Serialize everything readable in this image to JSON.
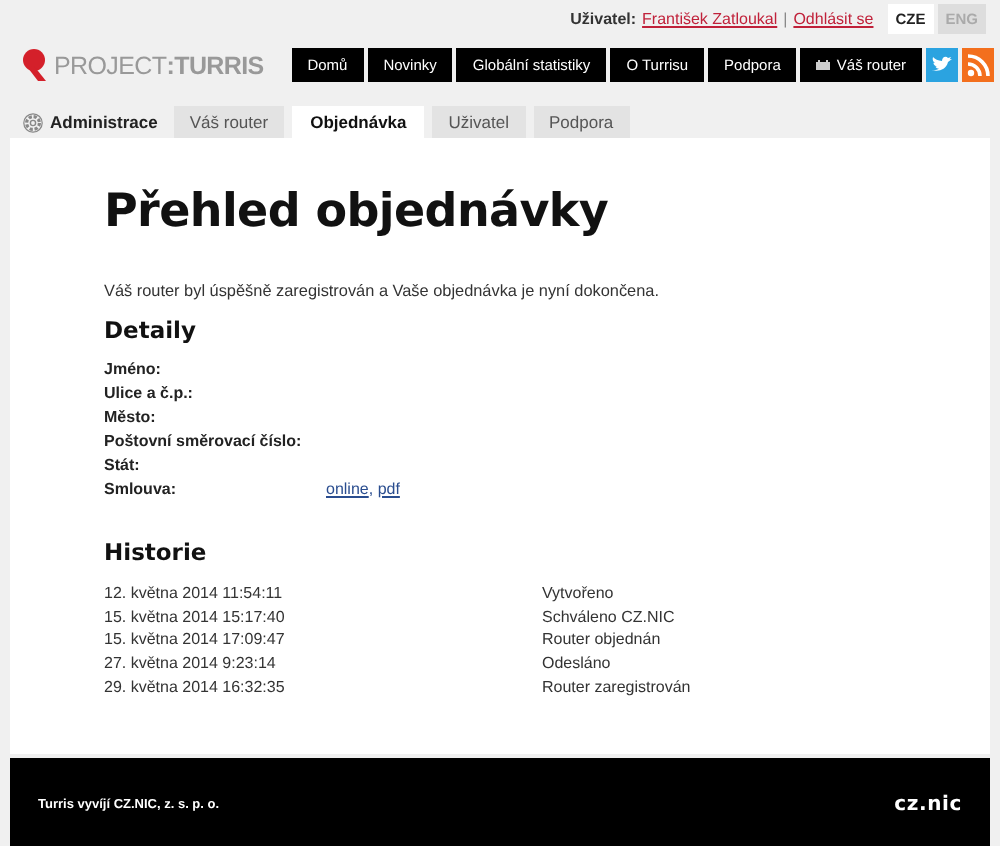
{
  "user_bar": {
    "label": "Uživatel:",
    "user": "František Zatloukal",
    "separator": "|",
    "logout": "Odhlásit se",
    "languages": [
      {
        "label": "CZE",
        "selected": true
      },
      {
        "label": "ENG",
        "selected": false
      }
    ]
  },
  "logo": "PROJECT**:TURRIS**",
  "nav": [
    {
      "label": "Domů",
      "kind": "text"
    },
    {
      "label": "Novinky",
      "kind": "text"
    },
    {
      "label": "Globální statistiky",
      "kind": "text"
    },
    {
      "label": "O Turrisu",
      "kind": "text"
    },
    {
      "label": "Podpora",
      "kind": "text"
    },
    {
      "label": "Váš router",
      "kind": "router"
    }
  ],
  "social": [
    {
      "kind": "twitter"
    },
    {
      "kind": "rss"
    }
  ],
  "admin_label": "Administrace",
  "tabs": [
    {
      "label": "Váš router",
      "selected": false
    },
    {
      "label": "Objednávka",
      "selected": true
    },
    {
      "label": "Uživatel",
      "selected": false
    },
    {
      "label": "Podpora",
      "selected": false
    }
  ],
  "title": "Přehled objednávky",
  "message": "Váš router byl úspěšně zaregistrován a Vaše objednávka je nyní dokončena.",
  "details": {
    "heading": "Detaily",
    "fields": [
      {
        "label": "Jméno:"
      },
      {
        "label": "Ulice a č.p.:"
      },
      {
        "label": "Město:"
      },
      {
        "label": "Poštovní směrovací číslo:"
      },
      {
        "label": "Stát:"
      },
      {
        "label": "Smlouva:",
        "links": [
          "online",
          ", ",
          "pdf"
        ]
      }
    ]
  },
  "history": {
    "heading": "Historie",
    "rows": [
      {
        "time": "12. května 2014 11:54:11",
        "event": "Vytvořeno"
      },
      {
        "time": "15. května 2014 15:17:40",
        "event": "Schváleno CZ.NIC"
      },
      {
        "time": "15. května 2014 17:09:47",
        "event": "Router objednán"
      },
      {
        "time": "27. května 2014 9:23:14",
        "event": "Odesláno"
      },
      {
        "time": "29. května 2014 16:32:35",
        "event": "Router zaregistrován"
      }
    ]
  },
  "footer": {
    "text": "Turris vyvíjí CZ.NIC, z. s. p. o.",
    "logo": "cz.nic"
  }
}
